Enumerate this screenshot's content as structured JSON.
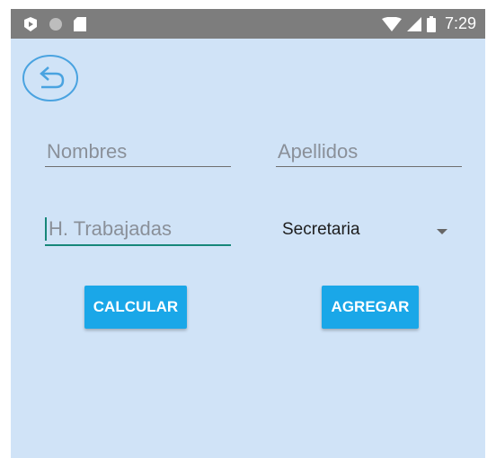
{
  "statusbar": {
    "time": "7:29",
    "icons": [
      "play-badge-icon",
      "circle-icon",
      "sd-card-icon",
      "wifi-icon",
      "signal-icon",
      "battery-icon"
    ]
  },
  "back_button": {
    "icon": "back-arrow-icon",
    "color": "#4aa3e0"
  },
  "form": {
    "nombres_placeholder": "Nombres",
    "apellidos_placeholder": "Apellidos",
    "horas_placeholder": "H. Trabajadas",
    "cargo_selected": "Secretaria"
  },
  "buttons": {
    "calcular": "CALCULAR",
    "agregar": "AGREGAR"
  },
  "colors": {
    "background": "#d0e3f7",
    "statusbar": "#7d7d7d",
    "accent_button": "#1aa7e8",
    "focus_underline": "#16877a"
  }
}
